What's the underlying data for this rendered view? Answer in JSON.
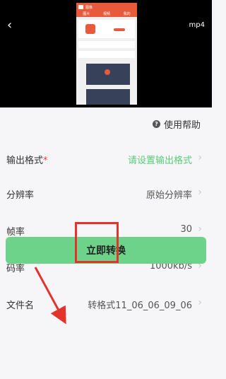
{
  "top": {
    "back_icon": "‹",
    "format_badge": "mp4",
    "preview": {
      "app_title": "图像",
      "tabs": [
        "图片",
        "视频",
        "我的"
      ]
    }
  },
  "help": {
    "icon": "?",
    "label": "使用帮助"
  },
  "settings": [
    {
      "label": "输出格式",
      "required": true,
      "value": "请设置输出格式",
      "value_color": "#5bc97a"
    },
    {
      "label": "分辨率",
      "required": false,
      "value": "原始分辨率"
    },
    {
      "label": "帧率",
      "required": false,
      "value": "30"
    },
    {
      "label": "码率",
      "required": false,
      "value": "1000kb/s"
    },
    {
      "label": "文件名",
      "required": false,
      "value": "转格式11_06_06_09_06"
    }
  ],
  "chevron": "›",
  "required_mark": "*",
  "convert_button": {
    "label": "立即转换"
  },
  "colors": {
    "accent": "#6ed38a",
    "annotation": "#e2332d",
    "brand": "#e85a3c"
  }
}
